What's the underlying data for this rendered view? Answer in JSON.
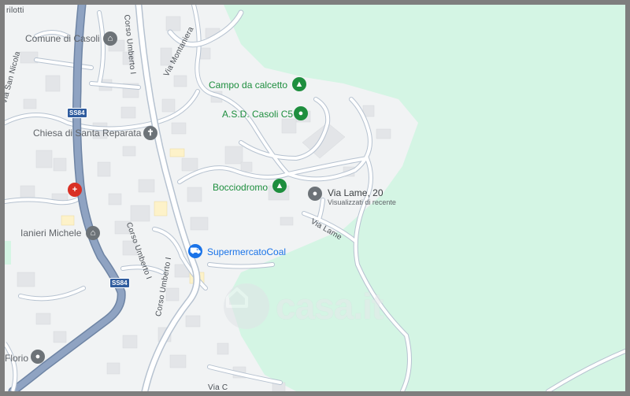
{
  "map": {
    "colors": {
      "background": "#f1f3f4",
      "park": "#d4f5e4",
      "road": "#ffffff",
      "road_outline": "#b6c2d0",
      "highway": "#8095b3",
      "building": "#e3e5e8"
    },
    "pois": [
      {
        "name": "Comune di Casoli",
        "icon": "landmark-icon",
        "color": "gray"
      },
      {
        "name": "Chiesa di Santa Reparata",
        "icon": "cross-icon",
        "color": "gray"
      },
      {
        "name": "Ianieri Michele",
        "icon": "landmark-icon",
        "color": "gray"
      },
      {
        "name": "Campo da calcetto",
        "icon": "tree-icon",
        "color": "green"
      },
      {
        "name": "A.S.D. Casoli C5",
        "icon": "pin-icon",
        "color": "green"
      },
      {
        "name": "Bocciodromo",
        "icon": "tree-icon",
        "color": "green"
      },
      {
        "name": "SupermercatoCoal",
        "icon": "cart-icon",
        "color": "blue"
      },
      {
        "name": "Florio",
        "icon": "pin-icon",
        "color": "gray"
      }
    ],
    "selected_place": {
      "name": "Via Lame, 20",
      "subtitle": "Visualizzati di recente",
      "icon": "recent-pin-icon"
    },
    "streets": [
      "Corso Umberto I",
      "Via Montaniera",
      "Via San Nicola",
      "rilotti",
      "Via Lame",
      "Corso Umberto I",
      "Corso Umberto I",
      "Via C"
    ],
    "road_shields": [
      "SS84",
      "SS84"
    ],
    "watermark": "casa.it"
  }
}
